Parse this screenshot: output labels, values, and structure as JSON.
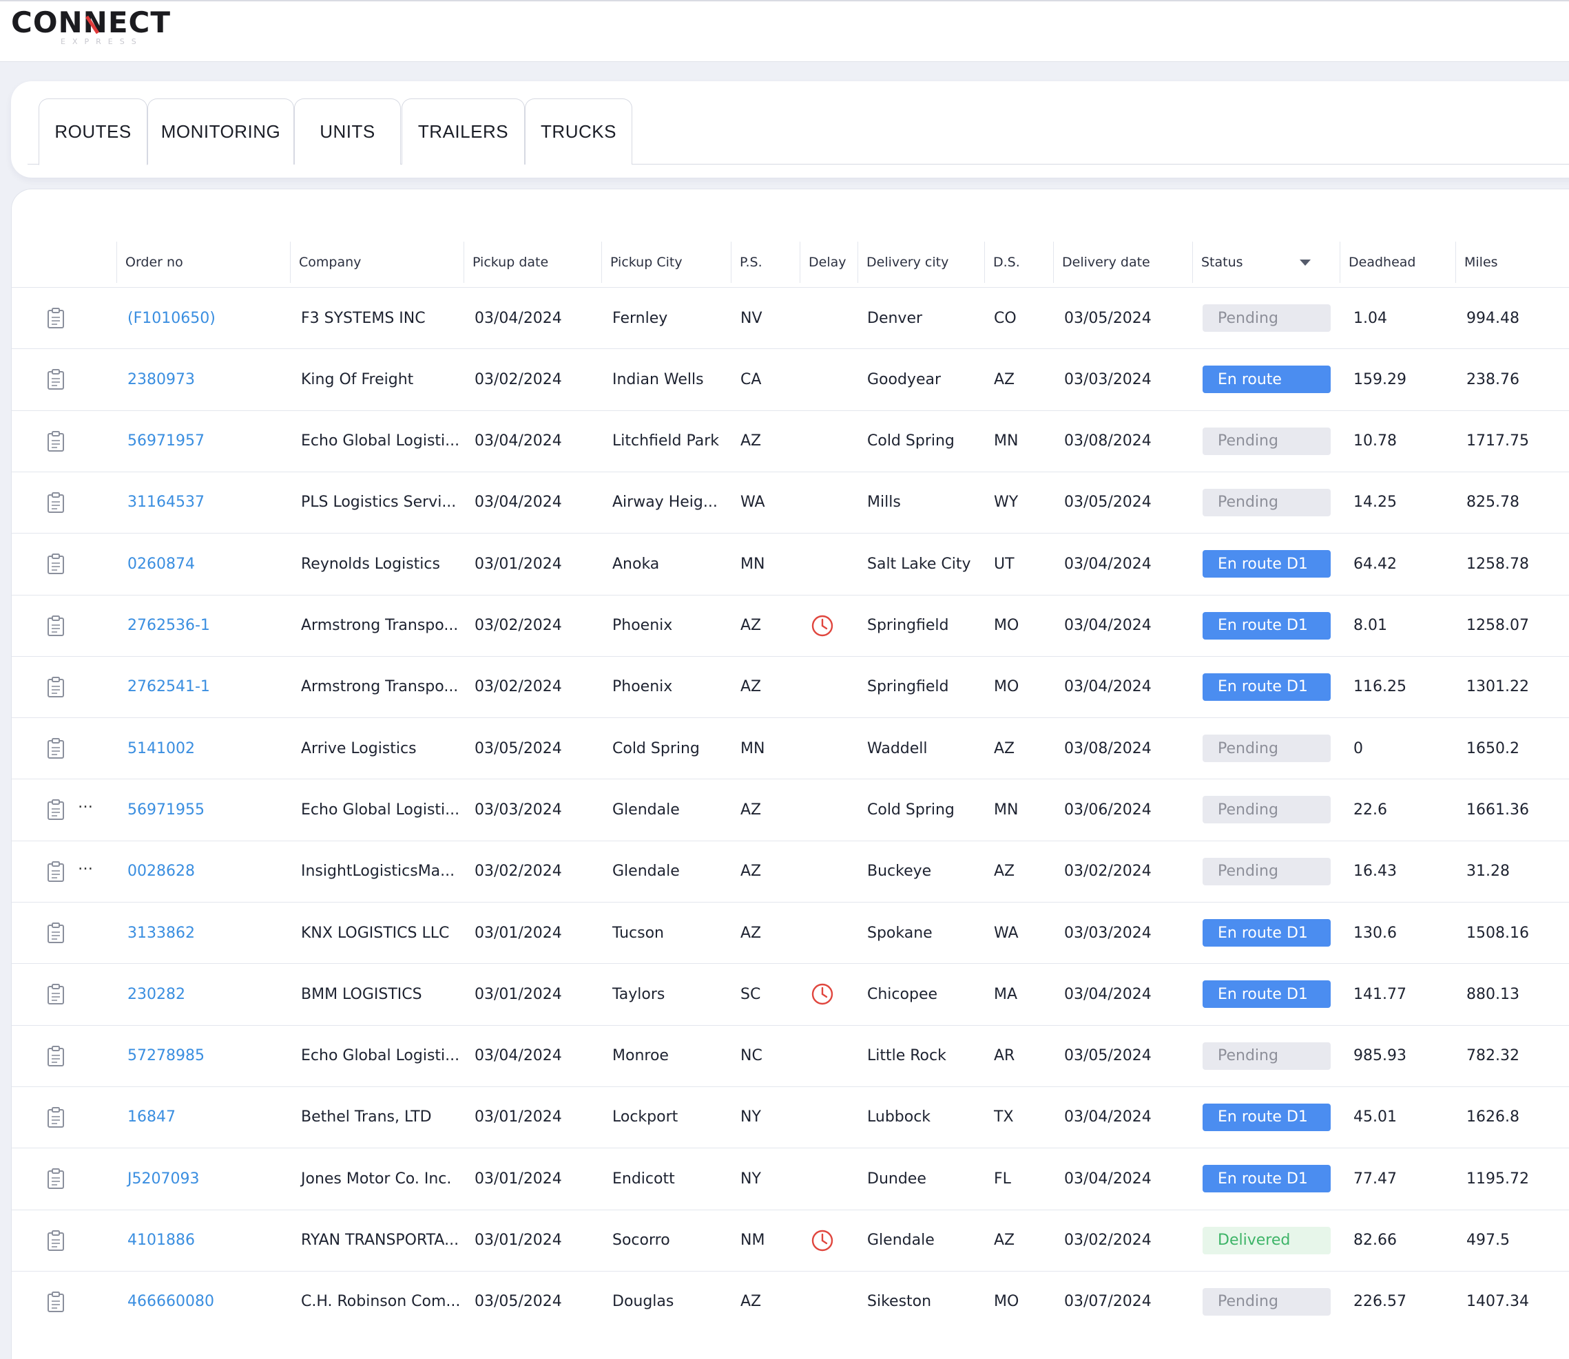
{
  "app": {
    "logo_text": "CONNECT",
    "logo_subtext": "EXPRESS"
  },
  "tabs": [
    {
      "label": "ROUTES",
      "active": true
    },
    {
      "label": "MONITORING",
      "active": false
    },
    {
      "label": "UNITS",
      "active": false
    },
    {
      "label": "TRAILERS",
      "active": false
    },
    {
      "label": "TRUCKS",
      "active": false
    }
  ],
  "table": {
    "columns": [
      "Order no",
      "Company",
      "Pickup date",
      "Pickup City",
      "P.S.",
      "Delay",
      "Delivery city",
      "D.S.",
      "Delivery date",
      "Status",
      "Deadhead",
      "Miles"
    ],
    "rows": [
      {
        "order": "(F1010650)",
        "company": "F3 SYSTEMS INC",
        "pickup_date": "03/04/2024",
        "pickup_city": "Fernley",
        "ps": "NV",
        "delay": false,
        "delivery_city": "Denver",
        "ds": "CO",
        "delivery_date": "03/05/2024",
        "status": "Pending",
        "deadhead": "1.04",
        "miles": "994.48",
        "dots": false
      },
      {
        "order": "2380973",
        "company": "King Of Freight",
        "pickup_date": "03/02/2024",
        "pickup_city": "Indian Wells",
        "ps": "CA",
        "delay": false,
        "delivery_city": "Goodyear",
        "ds": "AZ",
        "delivery_date": "03/03/2024",
        "status": "En route",
        "deadhead": "159.29",
        "miles": "238.76",
        "dots": false
      },
      {
        "order": "56971957",
        "company": "Echo Global Logisti...",
        "pickup_date": "03/04/2024",
        "pickup_city": "Litchfield Park",
        "ps": "AZ",
        "delay": false,
        "delivery_city": "Cold Spring",
        "ds": "MN",
        "delivery_date": "03/08/2024",
        "status": "Pending",
        "deadhead": "10.78",
        "miles": "1717.75",
        "dots": false
      },
      {
        "order": "31164537",
        "company": "PLS Logistics Servi...",
        "pickup_date": "03/04/2024",
        "pickup_city": "Airway Heig...",
        "ps": "WA",
        "delay": false,
        "delivery_city": "Mills",
        "ds": "WY",
        "delivery_date": "03/05/2024",
        "status": "Pending",
        "deadhead": "14.25",
        "miles": "825.78",
        "dots": false
      },
      {
        "order": "0260874",
        "company": "Reynolds Logistics",
        "pickup_date": "03/01/2024",
        "pickup_city": "Anoka",
        "ps": "MN",
        "delay": false,
        "delivery_city": "Salt Lake City",
        "ds": "UT",
        "delivery_date": "03/04/2024",
        "status": "En route D1",
        "deadhead": "64.42",
        "miles": "1258.78",
        "dots": false
      },
      {
        "order": "2762536-1",
        "company": "Armstrong Transpo...",
        "pickup_date": "03/02/2024",
        "pickup_city": "Phoenix",
        "ps": "AZ",
        "delay": true,
        "delivery_city": "Springfield",
        "ds": "MO",
        "delivery_date": "03/04/2024",
        "status": "En route D1",
        "deadhead": "8.01",
        "miles": "1258.07",
        "dots": false
      },
      {
        "order": "2762541-1",
        "company": "Armstrong Transpo...",
        "pickup_date": "03/02/2024",
        "pickup_city": "Phoenix",
        "ps": "AZ",
        "delay": false,
        "delivery_city": "Springfield",
        "ds": "MO",
        "delivery_date": "03/04/2024",
        "status": "En route D1",
        "deadhead": "116.25",
        "miles": "1301.22",
        "dots": false
      },
      {
        "order": "5141002",
        "company": "Arrive Logistics",
        "pickup_date": "03/05/2024",
        "pickup_city": "Cold Spring",
        "ps": "MN",
        "delay": false,
        "delivery_city": "Waddell",
        "ds": "AZ",
        "delivery_date": "03/08/2024",
        "status": "Pending",
        "deadhead": "0",
        "miles": "1650.2",
        "dots": false
      },
      {
        "order": "56971955",
        "company": "Echo Global Logisti...",
        "pickup_date": "03/03/2024",
        "pickup_city": "Glendale",
        "ps": "AZ",
        "delay": false,
        "delivery_city": "Cold Spring",
        "ds": "MN",
        "delivery_date": "03/06/2024",
        "status": "Pending",
        "deadhead": "22.6",
        "miles": "1661.36",
        "dots": true
      },
      {
        "order": "0028628",
        "company": "InsightLogisticsMa...",
        "pickup_date": "03/02/2024",
        "pickup_city": "Glendale",
        "ps": "AZ",
        "delay": false,
        "delivery_city": "Buckeye",
        "ds": "AZ",
        "delivery_date": "03/02/2024",
        "status": "Pending",
        "deadhead": "16.43",
        "miles": "31.28",
        "dots": true
      },
      {
        "order": "3133862",
        "company": "KNX LOGISTICS LLC",
        "pickup_date": "03/01/2024",
        "pickup_city": "Tucson",
        "ps": "AZ",
        "delay": false,
        "delivery_city": "Spokane",
        "ds": "WA",
        "delivery_date": "03/03/2024",
        "status": "En route D1",
        "deadhead": "130.6",
        "miles": "1508.16",
        "dots": false
      },
      {
        "order": "230282",
        "company": "BMM LOGISTICS",
        "pickup_date": "03/01/2024",
        "pickup_city": "Taylors",
        "ps": "SC",
        "delay": true,
        "delivery_city": "Chicopee",
        "ds": "MA",
        "delivery_date": "03/04/2024",
        "status": "En route D1",
        "deadhead": "141.77",
        "miles": "880.13",
        "dots": false
      },
      {
        "order": "57278985",
        "company": "Echo Global Logisti...",
        "pickup_date": "03/04/2024",
        "pickup_city": "Monroe",
        "ps": "NC",
        "delay": false,
        "delivery_city": "Little Rock",
        "ds": "AR",
        "delivery_date": "03/05/2024",
        "status": "Pending",
        "deadhead": "985.93",
        "miles": "782.32",
        "dots": false
      },
      {
        "order": "16847",
        "company": "Bethel Trans, LTD",
        "pickup_date": "03/01/2024",
        "pickup_city": "Lockport",
        "ps": "NY",
        "delay": false,
        "delivery_city": "Lubbock",
        "ds": "TX",
        "delivery_date": "03/04/2024",
        "status": "En route D1",
        "deadhead": "45.01",
        "miles": "1626.8",
        "dots": false
      },
      {
        "order": "J5207093",
        "company": "Jones Motor Co. Inc.",
        "pickup_date": "03/01/2024",
        "pickup_city": "Endicott",
        "ps": "NY",
        "delay": false,
        "delivery_city": "Dundee",
        "ds": "FL",
        "delivery_date": "03/04/2024",
        "status": "En route D1",
        "deadhead": "77.47",
        "miles": "1195.72",
        "dots": false
      },
      {
        "order": "4101886",
        "company": "RYAN TRANSPORTA...",
        "pickup_date": "03/01/2024",
        "pickup_city": "Socorro",
        "ps": "NM",
        "delay": true,
        "delivery_city": "Glendale",
        "ds": "AZ",
        "delivery_date": "03/02/2024",
        "status": "Delivered",
        "deadhead": "82.66",
        "miles": "497.5",
        "dots": false
      },
      {
        "order": "466660080",
        "company": "C.H. Robinson Com...",
        "pickup_date": "03/05/2024",
        "pickup_city": "Douglas",
        "ps": "AZ",
        "delay": false,
        "delivery_city": "Sikeston",
        "ds": "MO",
        "delivery_date": "03/07/2024",
        "status": "Pending",
        "deadhead": "226.57",
        "miles": "1407.34",
        "dots": false
      }
    ]
  },
  "colors": {
    "link": "#3a8ee0",
    "en_route": "#4b8df0",
    "pending_bg": "#e8e9ef",
    "delivered_text": "#3eb468",
    "delay_icon": "#e0463e"
  },
  "icons": {
    "row_action": "clipboard-icon",
    "delay": "clock-icon",
    "status_sort": "caret-down-icon"
  }
}
